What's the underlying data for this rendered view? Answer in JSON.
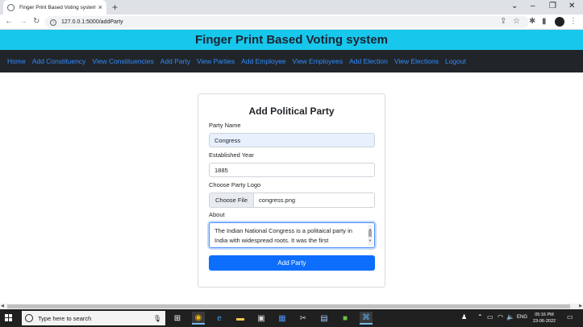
{
  "browser": {
    "tab_title": "Finger Print Based Voting system",
    "url": "127.0.0.1:5000/addParty"
  },
  "app": {
    "title": "Finger Print Based Voting system",
    "nav": [
      {
        "label": "Home"
      },
      {
        "label": "Add Constituency"
      },
      {
        "label": "View Constituencies"
      },
      {
        "label": "Add Party"
      },
      {
        "label": "View Parties"
      },
      {
        "label": "Add Employee"
      },
      {
        "label": "View Employees"
      },
      {
        "label": "Add Election"
      },
      {
        "label": "View Elections"
      },
      {
        "label": "Logout"
      }
    ]
  },
  "form": {
    "title": "Add Political Party",
    "party_name_label": "Party Name",
    "party_name_value": "Congress",
    "year_label": "Established Year",
    "year_value": "1885",
    "logo_label": "Choose Party Logo",
    "logo_button": "Choose File",
    "logo_file": "congress.png",
    "about_label": "About",
    "about_value": "The Indian National Congress is a politaical party in India with widespread roots. It was the first",
    "submit_label": "Add Party"
  },
  "taskbar": {
    "search_placeholder": "Type here to search",
    "language": "ENG",
    "time": "05:16 PM",
    "date": "23-06-2022"
  },
  "colors": {
    "header_bg": "#17c7ec",
    "navbar_bg": "#212529",
    "nav_link": "#2f8bff",
    "primary_button": "#0d6efd"
  }
}
